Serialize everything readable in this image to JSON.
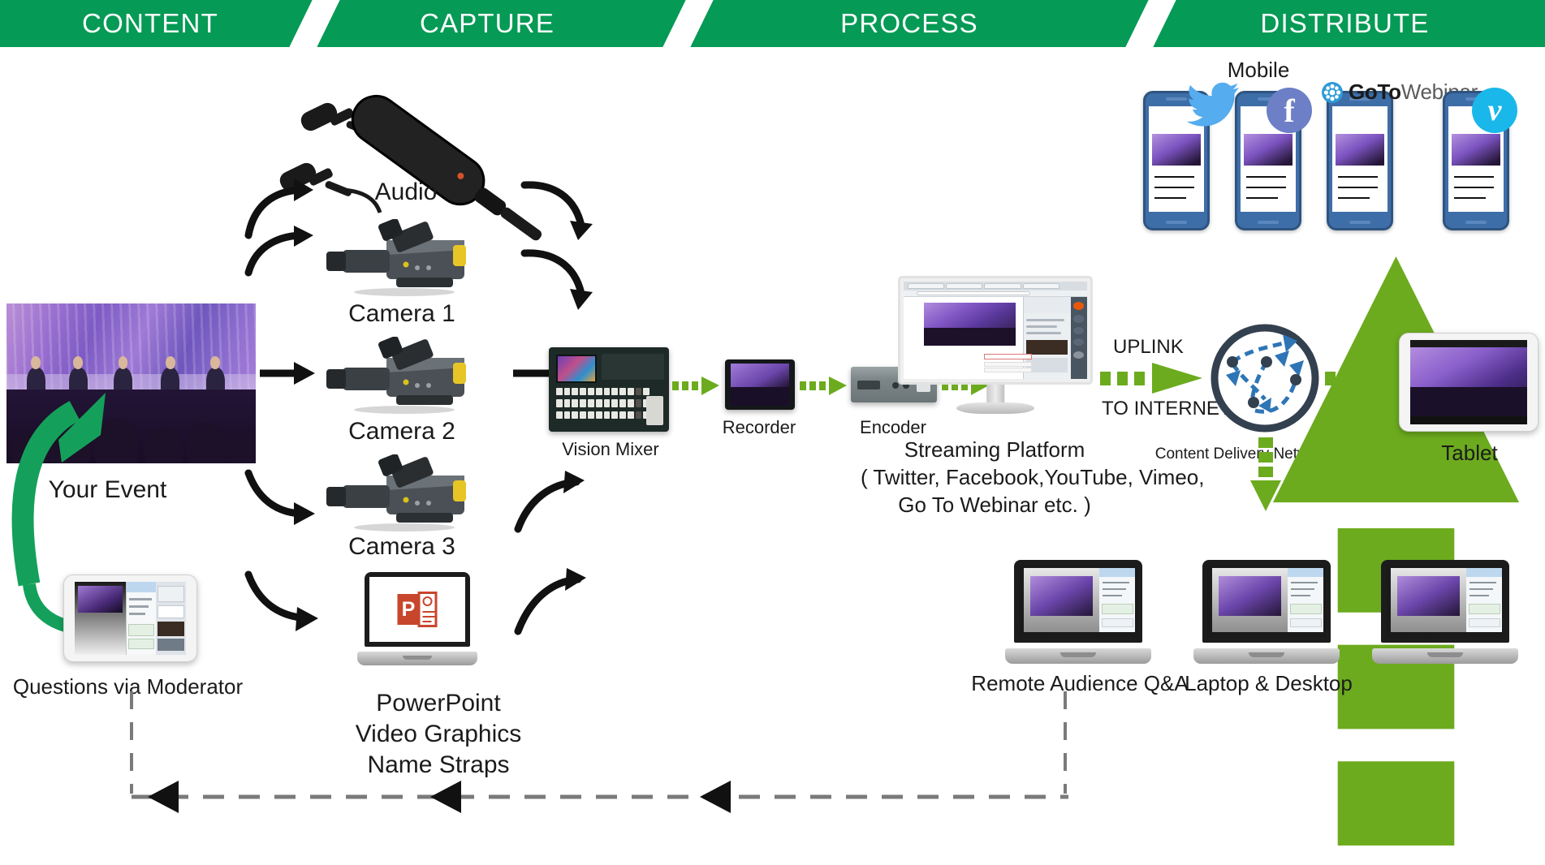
{
  "header": {
    "stages": [
      {
        "label": "CONTENT"
      },
      {
        "label": "CAPTURE"
      },
      {
        "label": "PROCESS"
      },
      {
        "label": "DISTRIBUTE"
      }
    ]
  },
  "colors": {
    "header_green": "#059A55",
    "flow_green": "#6CAB1E",
    "event_arrow_green": "#14A05A",
    "cdn_ring": "#33404F",
    "cdn_node_blue": "#2E75B6",
    "phone_blue": "#3E6EA8",
    "twitter_blue": "#55ACEE",
    "facebook_blue": "#6C7FC7",
    "vimeo_blue": "#1AB7EA",
    "powerpoint_red": "#C8462C",
    "dash_gray": "#7A7A7A"
  },
  "content": {
    "event_caption": "Your Event",
    "moderator_caption": "Questions via Moderator"
  },
  "capture": {
    "audio_caption": "Audio",
    "camera1_caption": "Camera 1",
    "camera2_caption": "Camera 2",
    "camera3_caption": "Camera 3",
    "graphics_caption_line1": "PowerPoint",
    "graphics_caption_line2": "Video Graphics",
    "graphics_caption_line3": "Name Straps",
    "powerpoint_glyph": "P"
  },
  "process": {
    "vision_mixer_caption": "Vision Mixer",
    "recorder_caption": "Recorder",
    "encoder_caption": "Encoder",
    "streaming_caption_line1": "Streaming Platform",
    "streaming_caption_line2": "( Twitter, Facebook,YouTube, Vimeo,",
    "streaming_caption_line3": "Go To Webinar etc. )",
    "uplink_label": "UPLINK",
    "internet_label": "TO INTERNET"
  },
  "distribute": {
    "mobile_caption": "Mobile",
    "cdn_caption": "Content Delivery Network (CDN)",
    "tablet_caption": "Tablet",
    "remote_audience_caption": "Remote Audience Q&A",
    "laptop_desktop_caption": "Laptop & Desktop",
    "phones": [
      {
        "name": "twitter",
        "badge": "twitter-icon"
      },
      {
        "name": "facebook",
        "badge": "facebook-icon",
        "glyph": "f"
      },
      {
        "name": "gotowebinar",
        "badge": "gotowebinar-icon"
      },
      {
        "name": "vimeo",
        "badge": "vimeo-icon",
        "glyph": "v"
      }
    ],
    "gotowebinar_bold": "GoTo",
    "gotowebinar_normal": "Webinar"
  }
}
